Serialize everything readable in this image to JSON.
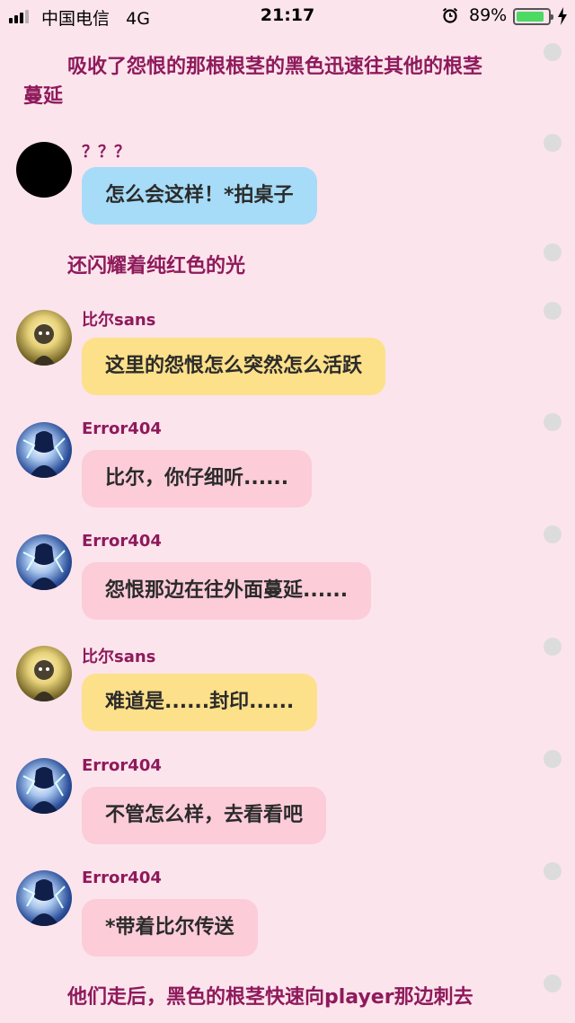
{
  "status_bar": {
    "carrier": "中国电信",
    "network": "4G",
    "time": "21:17",
    "battery_percent": "89%",
    "battery_level": 0.89,
    "icons": [
      "signal-icon",
      "alarm-icon",
      "battery-icon",
      "charging-icon"
    ]
  },
  "colors": {
    "background": "#fce4ec",
    "name_text": "#8e1a5b",
    "bubble_blue": "#a6dcf7",
    "bubble_yellow": "#fde08a",
    "bubble_pink": "#fcccd9"
  },
  "chat": {
    "narration_1_line1": "吸收了怨恨的那根根茎的黑色迅速往其他的根茎",
    "narration_1_line2": "蔓延",
    "narration_2": "还闪耀着纯红色的光",
    "narration_3": "他们走后，黑色的根茎快速向player那边刺去",
    "messages": [
      {
        "sender": "？？？",
        "text": "怎么会这样！*拍桌子",
        "avatar": "black-avatar"
      },
      {
        "sender": "比尔sans",
        "text": "这里的怨恨怎么突然怎么活跃",
        "avatar": "sans-avatar"
      },
      {
        "sender": "Error404",
        "text": "比尔，你仔细听......",
        "avatar": "error-avatar"
      },
      {
        "sender": "Error404",
        "text": "怨恨那边在往外面蔓延......",
        "avatar": "error-avatar"
      },
      {
        "sender": "比尔sans",
        "text": "难道是......封印......",
        "avatar": "sans-avatar"
      },
      {
        "sender": "Error404",
        "text": "不管怎么样，去看看吧",
        "avatar": "error-avatar"
      },
      {
        "sender": "Error404",
        "text": "*带着比尔传送",
        "avatar": "error-avatar"
      }
    ]
  }
}
